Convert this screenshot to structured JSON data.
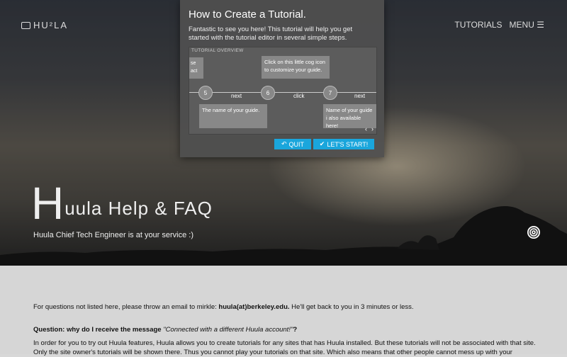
{
  "header": {
    "logo_text": "HU²LA",
    "nav_tutorials": "TUTORIALS",
    "nav_menu": "MENU",
    "menu_icon": "hamburger-icon"
  },
  "hero": {
    "title_initial": "H",
    "title_rest": "uula Help & FAQ",
    "subtitle": "Huula Chief Tech Engineer is at your service :)"
  },
  "modal": {
    "title": "How to Create a Tutorial.",
    "intro": "Fantastic to see you here! This tutorial will help you get started with the tutorial editor in several simple steps.",
    "overview_label": "TUTORIAL OVERVIEW",
    "tips": {
      "left_partial": "se\nact",
      "cog": "Click on this little cog icon to customize your guide.",
      "name": "The name of your guide.",
      "right_partial": "Name of your guide i also available here!"
    },
    "steps": [
      {
        "number": "5"
      },
      {
        "number": "6"
      },
      {
        "number": "7"
      }
    ],
    "actions": [
      "next",
      "click",
      "next"
    ],
    "prev_arrow": "‹",
    "next_arrow": "›",
    "quit_label": "QUIT",
    "start_label": "LET'S START!"
  },
  "content": {
    "intro_prefix": "For questions not listed here, please throw an email to mirkle: ",
    "email": "huula(at)berkeley.edu.",
    "intro_suffix": " He'll get back to you in 3 minutes or less.",
    "question_prefix": "Question: why do I receive the message ",
    "question_quote": "\"Connected with a different Huula account!\"",
    "question_suffix": "?",
    "answer": "In order for you to try out Huula features, Huula allows you to create tutorials for any sites that has Huula installed. But these tutorials will not be associated with that site. Only the site owner's tutorials will be shown there. Thus you cannot play your tutorials on that site. Which also means that other people cannot mess up with your"
  },
  "colors": {
    "accent": "#1aa6dc",
    "modal_bg": "#505050",
    "content_bg": "#d6d6d6"
  }
}
